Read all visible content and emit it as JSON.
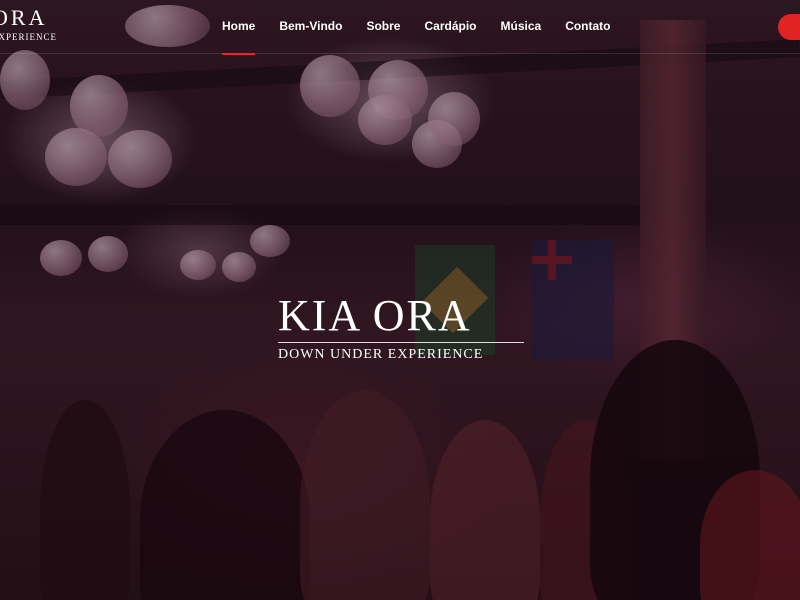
{
  "brand": {
    "name": "ORA",
    "tagline": "EXPERIENCE"
  },
  "nav": {
    "items": [
      {
        "label": "Home",
        "active": true
      },
      {
        "label": "Bem-Vindo",
        "active": false
      },
      {
        "label": "Sobre",
        "active": false
      },
      {
        "label": "Cardápio",
        "active": false
      },
      {
        "label": "Música",
        "active": false
      },
      {
        "label": "Contato",
        "active": false
      }
    ]
  },
  "hero": {
    "logo_name": "KIA ORA",
    "logo_tagline": "DOWN UNDER EXPERIENCE"
  },
  "colors": {
    "accent": "#e02424",
    "text": "#ffffff"
  }
}
